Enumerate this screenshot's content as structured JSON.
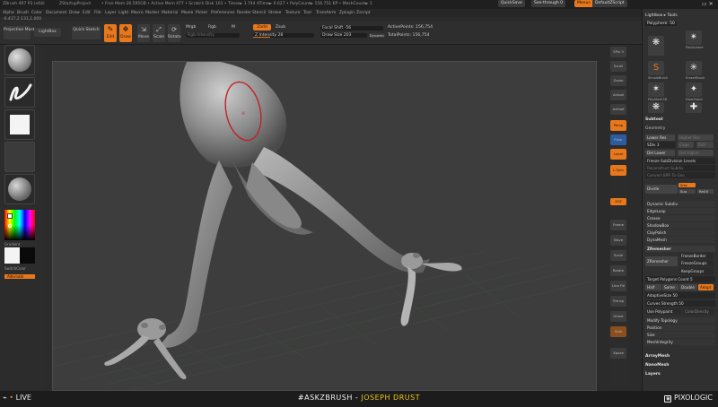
{
  "titlebar": {
    "app_name": "ZBrush 4R7 P3 (x64)",
    "project": "ZStartupProject",
    "status": "• Free Mem 26.595GB • Active Mem 477 • Scratch Disk 101 • Timer► 1.744 ATime► 0.027 • PolyCount► 156.751 KP • MeshCount► 1",
    "quicksave": "QuickSave",
    "see_through": "See-through  0",
    "menus_btn": "Menus",
    "script": "DefaultZScript"
  },
  "menubar": {
    "items": [
      "Alpha",
      "Brush",
      "Color",
      "Document",
      "Draw",
      "Edit",
      "File",
      "Layer",
      "Light",
      "Macro",
      "Marker",
      "Material",
      "Movie",
      "Picker",
      "Preferences",
      "Render",
      "Stencil",
      "Stroke",
      "Texture",
      "Tool",
      "Transform",
      "Zplugin",
      "Zscript"
    ]
  },
  "coordinates": "-0.437,2.131,1.000",
  "shelf": {
    "projection_master": "Projection Master",
    "lightbox": "LightBox",
    "quick_sketch": "Quick Sketch",
    "edit": "Edit",
    "draw": "Draw",
    "move": "Move",
    "scale": "Scale",
    "rotate": "Rotate",
    "mrgb": "Mrgb",
    "rgb": "Rgb",
    "m": "M",
    "rgb_intensity": "Rgb Intensity",
    "zadd": "Zadd",
    "zsub": "Zsub",
    "z_intensity": "Z Intensity 28",
    "focal_shift": "Focal Shift -56",
    "draw_size": "Draw Size 203",
    "dynamic": "Dynamic",
    "active_points": "ActivePoints: 156,754",
    "total_points": "TotalPoints: 156,754"
  },
  "leftbar": {
    "gradient": "Gradient",
    "switch_color": "SwitchColor",
    "alternate": "Alternate"
  },
  "right_toolbar": [
    {
      "label": "SPix 3",
      "style": "normal"
    },
    {
      "label": "Scroll",
      "style": "normal"
    },
    {
      "label": "Zoom",
      "style": "normal"
    },
    {
      "label": "Actual",
      "style": "normal"
    },
    {
      "label": "AAHalf",
      "style": "normal"
    },
    {
      "label": "Persp",
      "style": "or"
    },
    {
      "label": "Floor",
      "style": "bl"
    },
    {
      "label": "Local",
      "style": "or"
    },
    {
      "label": "L.Sym",
      "style": "or"
    },
    {
      "label": "XYZ",
      "style": "or"
    },
    {
      "label": "Frame",
      "style": "normal"
    },
    {
      "label": "Move",
      "style": "normal"
    },
    {
      "label": "Scale",
      "style": "normal"
    },
    {
      "label": "Rotate",
      "style": "normal"
    },
    {
      "label": "Line Fill",
      "style": "normal"
    },
    {
      "label": "Transp",
      "style": "normal"
    },
    {
      "label": "Ghost",
      "style": "normal"
    },
    {
      "label": "Solo",
      "style": "normal"
    },
    {
      "label": "Xpose",
      "style": "normal"
    }
  ],
  "panel": {
    "header": "Lightbox ▸ Tools",
    "tool_name": "Polyphere: 50",
    "brushes": [
      {
        "name": "Polyphere",
        "icon": "❋"
      },
      {
        "name": "PolySphere",
        "icon": "✴"
      },
      {
        "name": "SimpleBrush",
        "icon": "S"
      },
      {
        "name": "EraserBrush",
        "icon": "✳"
      },
      {
        "name": "PolyMesh3D",
        "icon": "✶"
      },
      {
        "name": "DamStand",
        "icon": "✦"
      },
      {
        "name": "Polyphere_1",
        "icon": "❋"
      },
      {
        "name": "ZSketch",
        "icon": "✚"
      }
    ],
    "subtool": "Subtool",
    "geometry": "Geometry",
    "lower_res": "Lower Res",
    "higher_res": "Higher Res",
    "sdiv": "SDiv 3",
    "cage": "Cage",
    "rstr": "Rstr",
    "del_lower": "Del Lower",
    "del_higher": "Del Higher",
    "freeze_subdiv": "Freeze SubDivision Levels",
    "reconstruct_subdiv": "Reconstruct Subdiv",
    "convert_bpr": "Convert BPR To Geo",
    "divide": "Divide",
    "smt": "Smt",
    "suv": "Suv",
    "reuv": "ReUV",
    "dynamic_subdiv": "Dynamic Subdiv",
    "edgeloop": "EdgeLoop",
    "crease": "Crease",
    "shadowbox": "ShadowBox",
    "claypolish": "ClayPolish",
    "dynamesh": "DynaMesh",
    "zremesher": "ZRemesher",
    "zremesher_btn": "ZRemesher",
    "freeze_border": "FreezeBorder",
    "freeze_groups": "FreezeGroups",
    "keep_groups": "KeepGroups",
    "target_polygons": "Target Polygons Count 5",
    "half": "Half",
    "same": "Same",
    "double": "Double",
    "adapt": "Adapt",
    "adaptive_size": "AdaptiveSize 50",
    "curves_strength": "Curves Strength 50",
    "use_polypaint": "Use Polypaint",
    "color_density": "ColorDensity",
    "modify_topology": "Modify Topology",
    "position": "Position",
    "size": "Size",
    "mesh_integrity": "MeshIntegrity",
    "arraymesh": "ArrayMesh",
    "nanomesh": "NanoMesh",
    "layers": "Layers"
  },
  "footer": {
    "live": "LIVE",
    "hashtag": "#ASKZBRUSH",
    "separator": " - ",
    "author": "JOSEPH DRUST",
    "brand": "PIXOLOGIC"
  },
  "colors": {
    "accent_orange": "#e8781b",
    "author_yellow": "#f0c419",
    "background": "#2b2b2b",
    "canvas": "#3d3d3d"
  }
}
